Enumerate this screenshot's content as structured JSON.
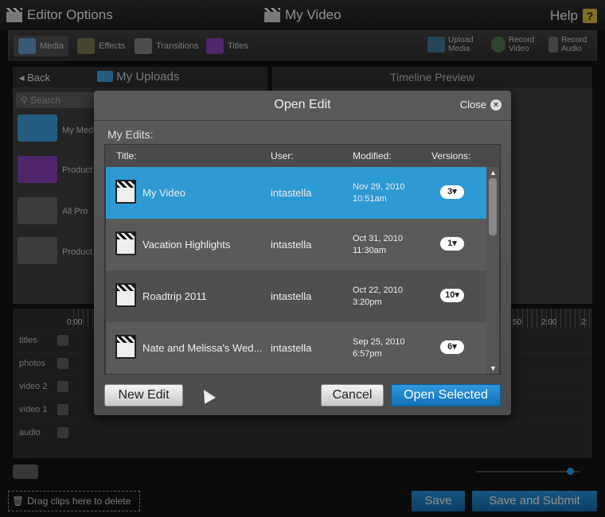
{
  "header": {
    "app_title": "Editor Options",
    "video_title": "My Video",
    "help_label": "Help",
    "help_icon": "?"
  },
  "toolbar": {
    "tabs": [
      {
        "label": "Media",
        "icon": "media-icon"
      },
      {
        "label": "Effects",
        "icon": "effects-icon"
      },
      {
        "label": "Transitions",
        "icon": "transitions-icon"
      },
      {
        "label": "Titles",
        "icon": "titles-icon"
      }
    ],
    "actions": [
      {
        "line1": "Upload",
        "line2": "Media"
      },
      {
        "line1": "Record",
        "line2": "Video"
      },
      {
        "line1": "Record",
        "line2": "Audio"
      }
    ]
  },
  "left_panel": {
    "back_label": "Back",
    "breadcrumb": "My Uploads",
    "search_placeholder": "Search",
    "folders": [
      "My Med",
      "Product",
      "All Pro",
      "Product"
    ],
    "folder_colors": [
      "#3a8fc8",
      "#7a3aa6",
      "#5c5c5c",
      "#5c5c5c"
    ]
  },
  "preview": {
    "title": "Timeline Preview"
  },
  "timeline": {
    "ticks": [
      "0:00",
      "50",
      "2:00",
      "2:"
    ],
    "tracks": [
      "titles",
      "photos",
      "video 2",
      "video 1",
      "audio"
    ]
  },
  "footer": {
    "drag_label": "Drag clips here to delete",
    "save_label": "Save",
    "save_submit_label": "Save and Submit"
  },
  "modal": {
    "title": "Open Edit",
    "close_label": "Close",
    "section_label": "My Edits:",
    "columns": [
      "Title:",
      "User:",
      "Modified:",
      "Versions:"
    ],
    "rows": [
      {
        "title": "My Video",
        "user": "intastella",
        "date": "Nov 29, 2010",
        "time": "10:51am",
        "versions": "3▾",
        "selected": true
      },
      {
        "title": "Vacation Highlights",
        "user": "intastella",
        "date": "Oct 31, 2010",
        "time": "11:30am",
        "versions": "1▾",
        "selected": false
      },
      {
        "title": "Roadtrip 2011",
        "user": "intastella",
        "date": "Oct 22, 2010",
        "time": "3:20pm",
        "versions": "10▾",
        "selected": false
      },
      {
        "title": "Nate and Melissa's Wed...",
        "user": "intastella",
        "date": "Sep 25, 2010",
        "time": "6:57pm",
        "versions": "6▾",
        "selected": false
      }
    ],
    "new_edit_label": "New Edit",
    "cancel_label": "Cancel",
    "open_selected_label": "Open Selected"
  },
  "colors": {
    "accent": "#2e9ad4",
    "background": "#111111",
    "modal": "#555555"
  }
}
